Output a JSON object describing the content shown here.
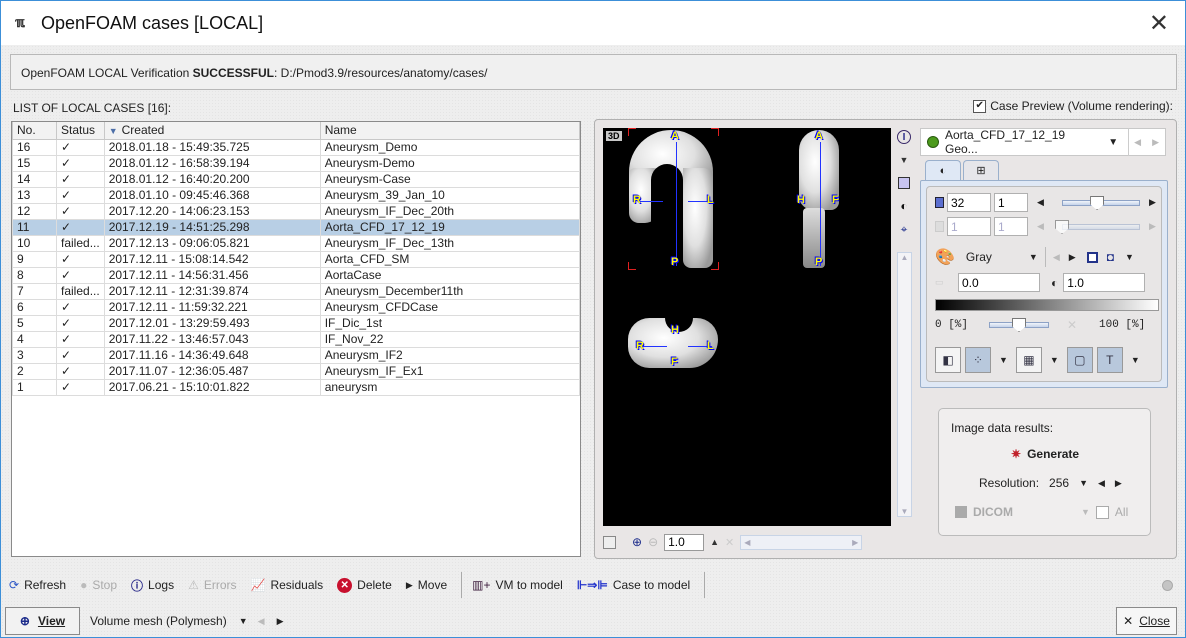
{
  "window": {
    "title": "OpenFOAM cases [LOCAL]",
    "app_icon": "openfoam-icon",
    "close_glyph": "✕"
  },
  "status": {
    "prefix": "OpenFOAM LOCAL Verification ",
    "state": "SUCCESSFUL",
    "suffix": ": D:/Pmod3.9/resources/anatomy/cases/"
  },
  "list": {
    "label": "LIST OF LOCAL CASES [16]:",
    "columns": [
      "No.",
      "Status",
      "Created",
      "Name"
    ],
    "sorted_column": "Created",
    "rows": [
      {
        "no": "16",
        "status": "✓",
        "created": "2018.01.18 - 15:49:35.725",
        "name": "Aneurysm_Demo"
      },
      {
        "no": "15",
        "status": "✓",
        "created": "2018.01.12 - 16:58:39.194",
        "name": "Aneurysm-Demo"
      },
      {
        "no": "14",
        "status": "✓",
        "created": "2018.01.12 - 16:40:20.200",
        "name": "Aneurysm-Case"
      },
      {
        "no": "13",
        "status": "✓",
        "created": "2018.01.10 - 09:45:46.368",
        "name": "Aneurysm_39_Jan_10"
      },
      {
        "no": "12",
        "status": "✓",
        "created": "2017.12.20 - 14:06:23.153",
        "name": "Aneurysm_IF_Dec_20th"
      },
      {
        "no": "11",
        "status": "✓",
        "created": "2017.12.19 - 14:51:25.298",
        "name": "Aorta_CFD_17_12_19",
        "selected": true
      },
      {
        "no": "10",
        "status": "failed...",
        "created": "2017.12.13 - 09:06:05.821",
        "name": "Aneurysm_IF_Dec_13th"
      },
      {
        "no": "9",
        "status": "✓",
        "created": "2017.12.11 - 15:08:14.542",
        "name": "Aorta_CFD_SM"
      },
      {
        "no": "8",
        "status": "✓",
        "created": "2017.12.11 - 14:56:31.456",
        "name": "AortaCase"
      },
      {
        "no": "7",
        "status": "failed...",
        "created": "2017.12.11 - 12:31:39.874",
        "name": "Aneurysm_December11th"
      },
      {
        "no": "6",
        "status": "✓",
        "created": "2017.12.11 - 11:59:32.221",
        "name": "Aneurysm_CFDCase"
      },
      {
        "no": "5",
        "status": "✓",
        "created": "2017.12.01 - 13:29:59.493",
        "name": "IF_Dic_1st"
      },
      {
        "no": "4",
        "status": "✓",
        "created": "2017.11.22 - 13:46:57.043",
        "name": "IF_Nov_22"
      },
      {
        "no": "3",
        "status": "✓",
        "created": "2017.11.16 - 14:36:49.648",
        "name": "Aneurysm_IF2"
      },
      {
        "no": "2",
        "status": "✓",
        "created": "2017.11.07 - 12:36:05.487",
        "name": "Aneurysm_IF_Ex1"
      },
      {
        "no": "1",
        "status": "✓",
        "created": "2017.06.21 - 15:10:01.822",
        "name": "aneurysm"
      }
    ]
  },
  "preview": {
    "checkbox_label": "Case Preview (Volume rendering):",
    "checked": true,
    "viewer": {
      "mode_tag": "3D",
      "orientation_labels": {
        "coronal": [
          "A",
          "R",
          "L",
          "P"
        ],
        "sagittal": [
          "A",
          "H",
          "F",
          "P"
        ],
        "axial": [
          "H",
          "R",
          "L",
          "F"
        ]
      },
      "zoom_value": "1.0"
    },
    "series_name": "Aorta_CFD_17_12_19 Geo...",
    "series_color": "#4c9a1c",
    "tabs": [
      "contrast-tab",
      "layout-tab"
    ],
    "slice": {
      "value": "32",
      "step": "1",
      "slider_fraction": 0.45
    },
    "frame": {
      "value": "1",
      "step": "1",
      "slider_fraction": 0.0
    },
    "colormap": "Gray",
    "lower": "0.0",
    "upper": "1.0",
    "pct_lower": "0 [%]",
    "pct_upper": "100 [%]",
    "opacity_slider_fraction": 0.5
  },
  "results": {
    "label": "Image data results:",
    "generate": "Generate",
    "resolution_label": "Resolution:",
    "resolution_value": "256",
    "format": "DICOM",
    "all_label": "All"
  },
  "toolbar": {
    "items": [
      {
        "label": "Refresh",
        "icon": "refresh-icon",
        "enabled": true
      },
      {
        "label": "Stop",
        "icon": "stop-icon",
        "enabled": false
      },
      {
        "label": "Logs",
        "icon": "info-icon",
        "enabled": true
      },
      {
        "label": "Errors",
        "icon": "warning-icon",
        "enabled": false
      },
      {
        "label": "Residuals",
        "icon": "residuals-chart-icon",
        "enabled": true
      },
      {
        "label": "Delete",
        "icon": "delete-icon",
        "enabled": true
      },
      {
        "label": "Move",
        "icon": "move-arrow-icon",
        "enabled": true
      },
      {
        "label": "VM to model",
        "icon": "mesh-add-icon",
        "enabled": true
      },
      {
        "label": "Case to model",
        "icon": "case-convert-icon",
        "enabled": true
      }
    ]
  },
  "bottom": {
    "view_label": "View",
    "mesh_select": "Volume mesh (Polymesh)",
    "close_label": "Close"
  }
}
